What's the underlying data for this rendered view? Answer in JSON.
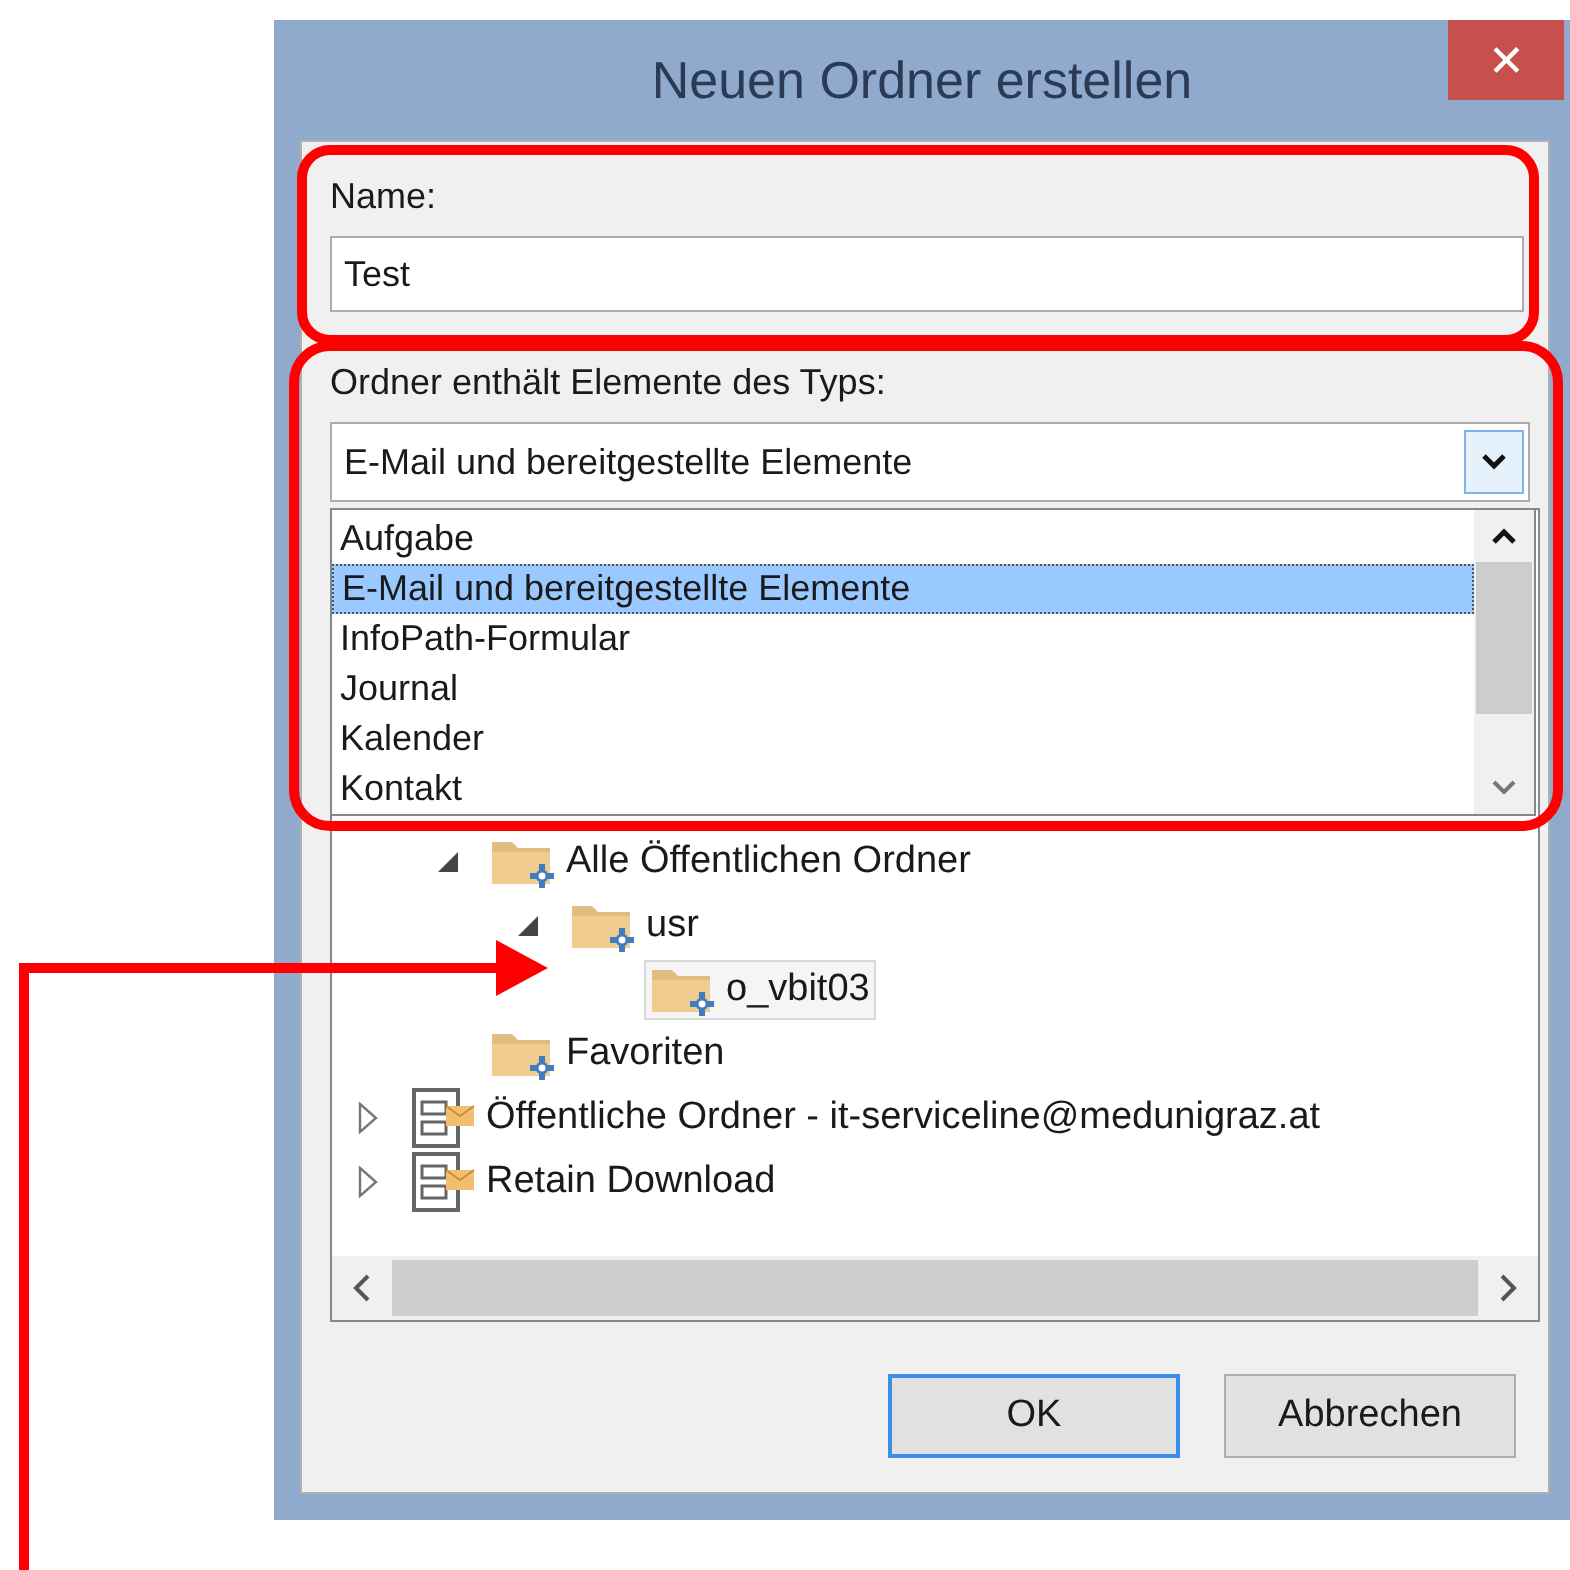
{
  "window": {
    "title": "Neuen Ordner erstellen",
    "close": "✕"
  },
  "name_field": {
    "label": "Name:",
    "value": "Test"
  },
  "type_field": {
    "label": "Ordner enthält Elemente des Typs:",
    "value": "E-Mail und bereitgestellte Elemente",
    "expanded": true,
    "options": [
      {
        "label": "Aufgabe",
        "selected": false
      },
      {
        "label": "E-Mail und bereitgestellte Elemente",
        "selected": true
      },
      {
        "label": "InfoPath-Formular",
        "selected": false
      },
      {
        "label": "Journal",
        "selected": false
      },
      {
        "label": "Kalender",
        "selected": false
      },
      {
        "label": "Kontakt",
        "selected": false
      }
    ]
  },
  "tree": {
    "items": [
      {
        "label": "Alle Öffentlichen Ordner",
        "kind": "folder",
        "expanded": true,
        "selected": false,
        "children": [
          {
            "label": "usr",
            "kind": "folder",
            "expanded": true,
            "selected": false,
            "children": [
              {
                "label": "o_vbit03",
                "kind": "folder",
                "selected": true
              }
            ]
          }
        ]
      },
      {
        "label": "Favoriten",
        "kind": "folder",
        "selected": false
      }
    ],
    "roots": [
      {
        "label": "Öffentliche Ordner - it-serviceline@medunigraz.at",
        "kind": "store",
        "expanded": false,
        "selected": false
      },
      {
        "label": "Retain Download",
        "kind": "store",
        "expanded": false,
        "selected": false
      }
    ]
  },
  "buttons": [
    {
      "label": "OK",
      "default": true
    },
    {
      "label": "Abbrechen",
      "default": false
    }
  ]
}
